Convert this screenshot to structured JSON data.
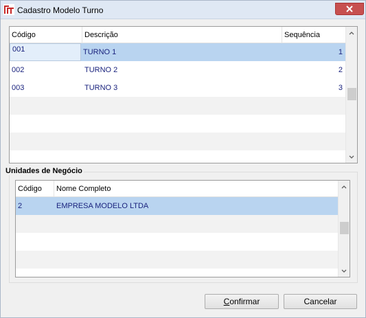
{
  "window": {
    "title": "Cadastro Modelo Turno"
  },
  "turnos": {
    "columns": [
      "Código",
      "Descrição",
      "Sequência"
    ],
    "rows": [
      {
        "codigo": "001",
        "descricao": "TURNO 1",
        "sequencia": "1"
      },
      {
        "codigo": "002",
        "descricao": "TURNO 2",
        "sequencia": "2"
      },
      {
        "codigo": "003",
        "descricao": "TURNO 3",
        "sequencia": "3"
      }
    ],
    "selected_row": 0
  },
  "unidades": {
    "group_title": "Unidades de Negócio",
    "columns": [
      "Código",
      "Nome Completo"
    ],
    "rows": [
      {
        "codigo": "2",
        "nome": "EMPRESA MODELO LTDA"
      }
    ],
    "selected_row": 0
  },
  "buttons": {
    "confirmar": {
      "mnemonic": "C",
      "rest": "onfirmar"
    },
    "cancelar": {
      "mnemonic": "",
      "rest": "Cancelar"
    }
  },
  "colors": {
    "selection": "#b9d4f0",
    "row_text": "#1a237e",
    "close_button": "#c75050"
  },
  "icons": {
    "app": "app-logo-icon",
    "close": "close-icon"
  }
}
